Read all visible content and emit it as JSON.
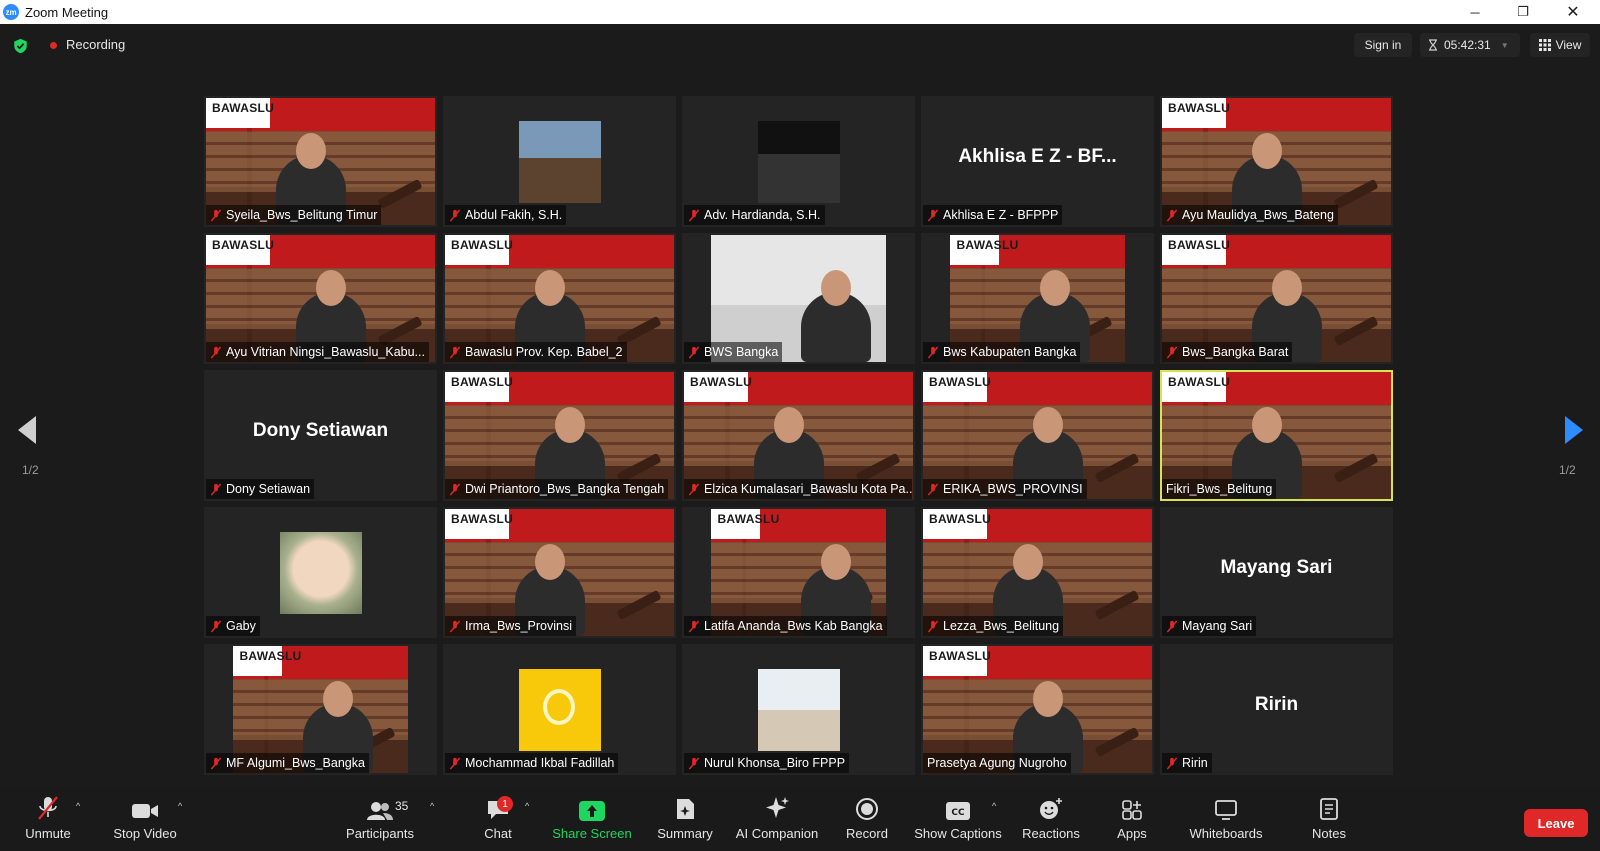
{
  "window": {
    "title": "Zoom Meeting",
    "logo_text": "zm",
    "min": "─",
    "max": "❐",
    "close": "✕"
  },
  "topbar": {
    "recording_label": "Recording",
    "sign_in": "Sign in",
    "timer": "05:42:31",
    "view": "View"
  },
  "pagination": {
    "left": "1/2",
    "right": "1/2"
  },
  "tiles": [
    {
      "name": "Syeila_Bws_Belitung Timur",
      "bg": "bawaslu"
    },
    {
      "name": "Abdul Fakih, S.H.",
      "bg": "portrait"
    },
    {
      "name": "Adv. Hardianda, S.H.",
      "bg": "dark"
    },
    {
      "name": "Akhlisa E Z - BFPPP",
      "bg": "avatar-text",
      "avatar_text": "Akhlisa E Z - BF..."
    },
    {
      "name": "Ayu Maulidya_Bws_Bateng",
      "bg": "bawaslu"
    },
    {
      "name": "Ayu Vitrian Ningsi_Bawaslu_Kabu...",
      "bg": "bawaslu"
    },
    {
      "name": "Bawaslu Prov. Kep. Babel_2",
      "bg": "bawaslu"
    },
    {
      "name": "BWS Bangka",
      "bg": "office"
    },
    {
      "name": "Bws Kabupaten Bangka",
      "bg": "bawaslu-partial"
    },
    {
      "name": "Bws_Bangka Barat",
      "bg": "bawaslu"
    },
    {
      "name": "Dony Setiawan",
      "bg": "avatar-text",
      "avatar_text": "Dony Setiawan"
    },
    {
      "name": "Dwi Priantoro_Bws_Bangka Tengah",
      "bg": "bawaslu"
    },
    {
      "name": "Elzica Kumalasari_Bawaslu Kota Pa...",
      "bg": "bawaslu"
    },
    {
      "name": "ERIKA_BWS_PROVINSI",
      "bg": "bawaslu"
    },
    {
      "name": "Fikri_Bws_Belitung",
      "bg": "bawaslu",
      "active": true,
      "muted": false
    },
    {
      "name": "Gaby",
      "bg": "cat"
    },
    {
      "name": "Irma_Bws_Provinsi",
      "bg": "bawaslu"
    },
    {
      "name": "Latifa Ananda_Bws Kab Bangka",
      "bg": "bawaslu-partial"
    },
    {
      "name": "Lezza_Bws_Belitung",
      "bg": "bawaslu"
    },
    {
      "name": "Mayang Sari",
      "bg": "avatar-text",
      "avatar_text": "Mayang Sari"
    },
    {
      "name": "MF Algumi_Bws_Bangka",
      "bg": "bawaslu-partial"
    },
    {
      "name": "Mochammad Ikbal Fadillah",
      "bg": "bulb"
    },
    {
      "name": "Nurul Khonsa_Biro FPPP",
      "bg": "room"
    },
    {
      "name": "Prasetya Agung Nugroho",
      "bg": "bawaslu",
      "muted": false
    },
    {
      "name": "Ririn",
      "bg": "avatar-text",
      "avatar_text": "Ririn"
    }
  ],
  "banner_text": "BAWASLU",
  "toolbar": {
    "unmute": "Unmute",
    "stop_video": "Stop Video",
    "participants": "Participants",
    "participants_count": "35",
    "chat": "Chat",
    "chat_badge": "1",
    "share_screen": "Share Screen",
    "summary": "Summary",
    "ai_companion": "AI Companion",
    "record": "Record",
    "show_captions": "Show Captions",
    "reactions": "Reactions",
    "apps": "Apps",
    "whiteboards": "Whiteboards",
    "notes": "Notes",
    "leave": "Leave"
  },
  "colors": {
    "active_speaker": "#d7e353",
    "share_green": "#1ed760",
    "leave_red": "#e02828",
    "accent_blue": "#2d8cff"
  }
}
